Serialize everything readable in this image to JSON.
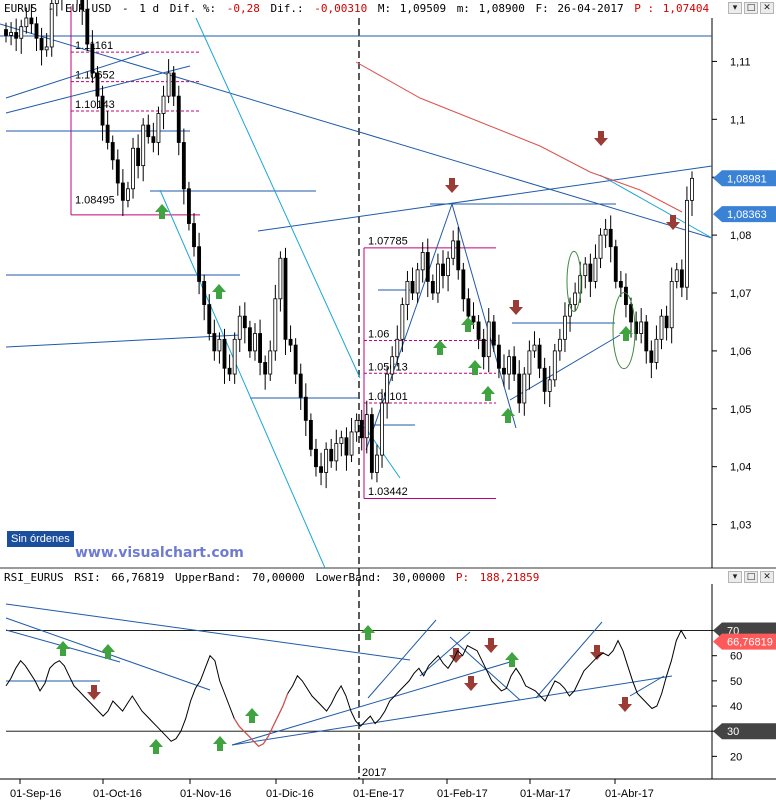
{
  "main_header": {
    "symbol": "EURUS",
    "pair": "EUR-USD",
    "timeframe": "1 d",
    "dif_pct_label": "Dif. %:",
    "dif_pct_value": "-0,28",
    "dif_label": "Dif.:",
    "dif_value": "-0,00310",
    "max_label": "M:",
    "max_value": "1,09509",
    "min_label": "m:",
    "min_value": "1,08900",
    "date_label": "F:",
    "date_value": "26-04-2017",
    "price_label": "P :",
    "price_value": "1,07404"
  },
  "rsi_header": {
    "name": "RSI_EURUS",
    "rsi_label": "RSI:",
    "rsi_value": "66,76819",
    "upper_label": "UpperBand:",
    "upper_value": "70,00000",
    "lower_label": "LowerBand:",
    "lower_value": "30,00000",
    "p_label": "P:",
    "p_value": "188,21859"
  },
  "window_buttons": [
    "▾",
    "□",
    "✕"
  ],
  "orders_label": "Sin órdenes",
  "watermark": "www.visualchart.com",
  "colors": {
    "bull": "#ffffff",
    "bear": "#000000",
    "trend_line": "#1f5aa8",
    "cyan_line": "#1aa6d9",
    "ma_line": "#d9534f",
    "retracement": "#c0007a",
    "arrow_up": "#3fa33f",
    "arrow_down": "#9b3b35",
    "price_tag": "#3a82d6",
    "rsi_tag": "#ff5a5a",
    "header_red": "#d40000",
    "header_blue": "#0000cc"
  },
  "chart_data": [
    {
      "type": "candlestick",
      "x_tick_labels": [
        "01-Sep-16",
        "01-Oct-16",
        "01-Nov-16",
        "01-Dic-16",
        "01-Ene-17",
        "01-Feb-17",
        "01-Mar-17",
        "01-Abr-17"
      ],
      "year_marker": "2017",
      "y_ticks": [
        "1,11",
        "1,1",
        "1,09",
        "1,08",
        "1,07",
        "1,06",
        "1,05",
        "1,04",
        "1,03"
      ],
      "ylim": [
        1.0225,
        1.1175
      ],
      "price_tags": [
        "1,08981",
        "1,08363"
      ],
      "retracement_labels": {
        "left": [
          "1.11161",
          "1.10652",
          "1.10143",
          "1.08495"
        ],
        "right": [
          "1.07785",
          "1.06",
          "1.05613",
          "1.05101",
          "1.03442"
        ]
      },
      "closes": [
        1.1145,
        1.115,
        1.114,
        1.116,
        1.1175,
        1.1165,
        1.114,
        1.112,
        1.1125,
        1.12,
        1.1215,
        1.123,
        1.1225,
        1.1235,
        1.122,
        1.119,
        1.113,
        1.108,
        1.104,
        1.099,
        1.096,
        1.093,
        1.089,
        1.086,
        1.088,
        1.095,
        1.092,
        1.099,
        1.097,
        1.096,
        1.101,
        1.104,
        1.108,
        1.104,
        1.096,
        1.088,
        1.082,
        1.078,
        1.072,
        1.068,
        1.063,
        1.06,
        1.062,
        1.057,
        1.056,
        1.062,
        1.066,
        1.064,
        1.06,
        1.063,
        1.058,
        1.056,
        1.06,
        1.069,
        1.076,
        1.062,
        1.061,
        1.056,
        1.052,
        1.048,
        1.043,
        1.04,
        1.039,
        1.043,
        1.041,
        1.044,
        1.045,
        1.042,
        1.046,
        1.048,
        1.045,
        1.049,
        1.039,
        1.042,
        1.051,
        1.056,
        1.059,
        1.062,
        1.068,
        1.072,
        1.07,
        1.074,
        1.077,
        1.072,
        1.07,
        1.075,
        1.073,
        1.076,
        1.079,
        1.074,
        1.069,
        1.066,
        1.065,
        1.062,
        1.059,
        1.065,
        1.061,
        1.057,
        1.056,
        1.059,
        1.056,
        1.051,
        1.056,
        1.06,
        1.061,
        1.057,
        1.053,
        1.055,
        1.06,
        1.062,
        1.066,
        1.068,
        1.07,
        1.073,
        1.075,
        1.072,
        1.076,
        1.08,
        1.081,
        1.078,
        1.072,
        1.071,
        1.068,
        1.065,
        1.063,
        1.065,
        1.06,
        1.058,
        1.062,
        1.066,
        1.064,
        1.072,
        1.074,
        1.071,
        1.086,
        1.0898
      ]
    },
    {
      "type": "line",
      "title": "RSI_EURUS",
      "y_ticks": [
        "70",
        "60",
        "50",
        "40",
        "30",
        "20"
      ],
      "bands": [
        70,
        30
      ],
      "value_tags": [
        "70",
        "66,76819",
        "30"
      ],
      "series": [
        {
          "name": "RSI",
          "values": [
            48,
            51,
            55,
            58,
            56,
            53,
            50,
            46,
            49,
            55,
            57,
            58,
            56,
            52,
            48,
            46,
            44,
            42,
            40,
            38,
            36,
            38,
            42,
            40,
            38,
            41,
            44,
            41,
            38,
            36,
            34,
            32,
            30,
            28,
            26,
            27,
            30,
            35,
            42,
            47,
            50,
            55,
            60,
            58,
            50,
            45,
            40,
            35,
            32,
            30,
            28,
            26,
            24,
            25,
            28,
            32,
            36,
            40,
            45,
            48,
            52,
            50,
            47,
            44,
            42,
            40,
            38,
            41,
            45,
            48,
            44,
            38,
            34,
            32,
            34,
            36,
            33,
            35,
            38,
            42,
            44,
            46,
            48,
            50,
            53,
            55,
            52,
            56,
            58,
            60,
            57,
            55,
            58,
            62,
            60,
            64,
            63,
            62,
            58,
            54,
            50,
            48,
            46,
            47,
            52,
            55,
            52,
            48,
            47,
            46,
            44,
            42,
            46,
            50,
            49,
            47,
            44,
            46,
            50,
            54,
            56,
            58,
            60,
            61,
            60,
            62,
            66,
            62,
            56,
            50,
            45,
            43,
            41,
            39,
            40,
            45,
            52,
            58,
            66,
            70,
            66.7
          ]
        }
      ]
    }
  ]
}
